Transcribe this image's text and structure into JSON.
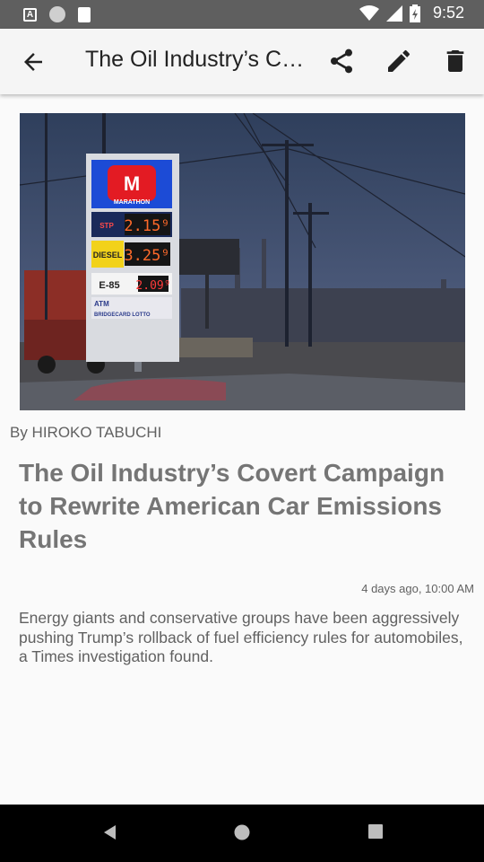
{
  "status_bar": {
    "time": "9:52",
    "icons": [
      "a-notification-icon",
      "circle-notification-icon",
      "sd-card-icon",
      "wifi-icon",
      "cell-signal-icon",
      "battery-charging-icon"
    ]
  },
  "app_bar": {
    "title": "The Oil Industry’s Covert Campaign to Rewrite American Car Emissions Rules",
    "actions": [
      "back-arrow-icon",
      "share-icon",
      "edit-pencil-icon",
      "delete-trash-icon"
    ]
  },
  "article": {
    "image_sign": {
      "brand": "MARATHON",
      "brand_letter": "M",
      "rows": [
        {
          "label": "STP",
          "price": "2.15⁹"
        },
        {
          "label": "DIESEL",
          "price": "3.25⁹"
        },
        {
          "label": "E-85",
          "price": "2.09⁹"
        }
      ],
      "footer_top": "ATM",
      "footer_bottom": "BRIDGECARD LOTTO"
    },
    "byline": "By HIROKO TABUCHI",
    "headline": "The Oil Industry’s Covert Campaign to Rewrite American Car Emissions Rules",
    "timestamp": "4 days ago, 10:00 AM",
    "summary": "Energy giants and conservative groups have been aggressively pushing Trump’s rollback of fuel efficiency rules for automobiles, a Times investigation found."
  },
  "colors": {
    "status_bar": "#5f5f5f",
    "app_bar": "#f5f5f5",
    "background": "#fafafa",
    "headline": "#757575",
    "nav_bar": "#000000"
  }
}
